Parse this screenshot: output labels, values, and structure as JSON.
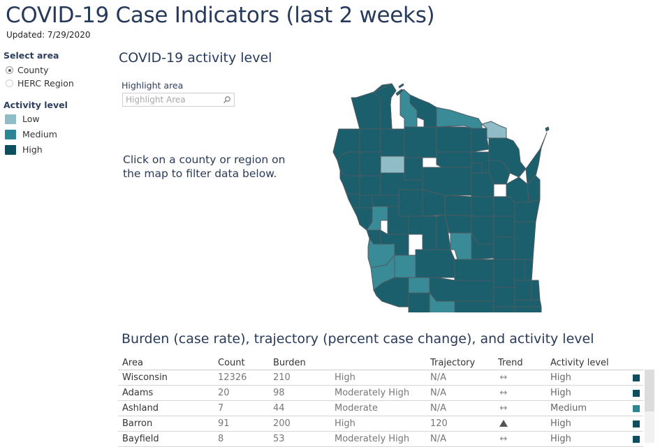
{
  "header": {
    "title": "COVID-19 Case Indicators (last 2 weeks)",
    "updated": "Updated: 7/29/2020"
  },
  "sidebar": {
    "select_area_label": "Select area",
    "area_options": [
      {
        "label": "County",
        "selected": true
      },
      {
        "label": "HERC Region",
        "selected": false
      }
    ],
    "activity_label": "Activity level",
    "legend": [
      {
        "label": "Low",
        "color": "#8fbcc6"
      },
      {
        "label": "Medium",
        "color": "#2b8594"
      },
      {
        "label": "High",
        "color": "#0c4f5e"
      }
    ]
  },
  "map_section": {
    "title": "COVID-19 activity level",
    "highlight_label": "Highlight area",
    "highlight_placeholder": "Highlight Area",
    "hint": "Click on a county or region on the map to filter data below.",
    "map_colors": {
      "Low": "#8fbcc6",
      "Medium": "#3a8b98",
      "High": "#1a5f6b"
    }
  },
  "table_section": {
    "title": "Burden (case rate), trajectory (percent case change), and activity level",
    "columns": [
      "Area",
      "Count",
      "Burden",
      "",
      "Trajectory",
      "Trend",
      "Activity level"
    ],
    "rows": [
      {
        "area": "Wisconsin",
        "count": "12326",
        "burden": "210",
        "burden_cat": "High",
        "trajectory": "N/A",
        "trend": "↔",
        "activity": "High",
        "color": "#0c4f5e"
      },
      {
        "area": "Adams",
        "count": "20",
        "burden": "98",
        "burden_cat": "Moderately High",
        "trajectory": "N/A",
        "trend": "↔",
        "activity": "High",
        "color": "#0c4f5e"
      },
      {
        "area": "Ashland",
        "count": "7",
        "burden": "44",
        "burden_cat": "Moderate",
        "trajectory": "N/A",
        "trend": "↔",
        "activity": "Medium",
        "color": "#2b8594"
      },
      {
        "area": "Barron",
        "count": "91",
        "burden": "200",
        "burden_cat": "High",
        "trajectory": "120",
        "trend": "▲",
        "activity": "High",
        "color": "#0c4f5e"
      },
      {
        "area": "Bayfield",
        "count": "8",
        "burden": "53",
        "burden_cat": "Moderately High",
        "trajectory": "N/A",
        "trend": "↔",
        "activity": "High",
        "color": "#0c4f5e"
      }
    ]
  }
}
